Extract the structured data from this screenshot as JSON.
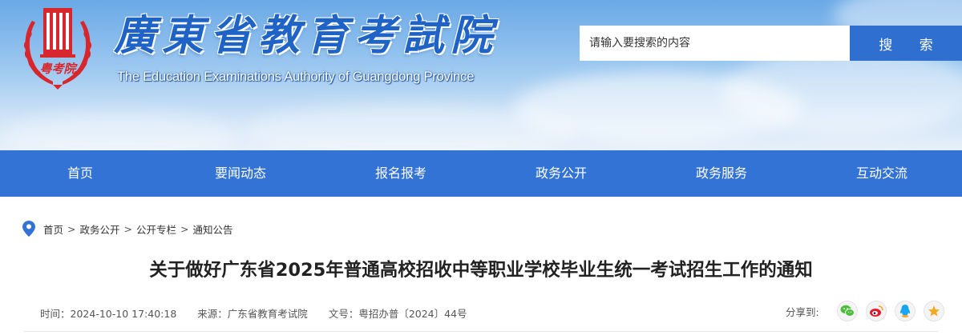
{
  "header": {
    "site_title": "廣東省教育考試院",
    "site_subtitle": "The Education Examinations Authority of Guangdong Province",
    "emblem_text": "粤考院",
    "search_placeholder": "请输入要搜索的内容",
    "search_button_label": "搜 索"
  },
  "nav": {
    "items": [
      "首页",
      "要闻动态",
      "报名报考",
      "政务公开",
      "政务服务",
      "互动交流"
    ]
  },
  "breadcrumb": {
    "icon": "location-pin-icon",
    "items": [
      "首页",
      "政务公开",
      "公开专栏",
      "通知公告"
    ],
    "separator": ">"
  },
  "article": {
    "title": "关于做好广东省2025年普通高校招收中等职业学校毕业生统一考试招生工作的通知",
    "meta": {
      "time_label": "时间：",
      "time_value": "2024-10-10 17:40:18",
      "source_label": "来源：",
      "source_value": "广东省教育考试院",
      "docno_label": "文号：",
      "docno_value": "粤招办普〔2024〕44号"
    }
  },
  "share": {
    "label": "分享到:",
    "targets": [
      {
        "icon": "wechat-icon",
        "color": "#4bbf3a"
      },
      {
        "icon": "weibo-icon",
        "color": "#e6162d"
      },
      {
        "icon": "qq-icon",
        "color": "#1aa5f0"
      },
      {
        "icon": "qzone-star-icon",
        "color": "#f5a623"
      }
    ]
  },
  "colors": {
    "brand_blue": "#1f63c7",
    "nav_blue": "#3373d5",
    "search_button": "#2f6fd0",
    "emblem_red": "#d7262c"
  }
}
